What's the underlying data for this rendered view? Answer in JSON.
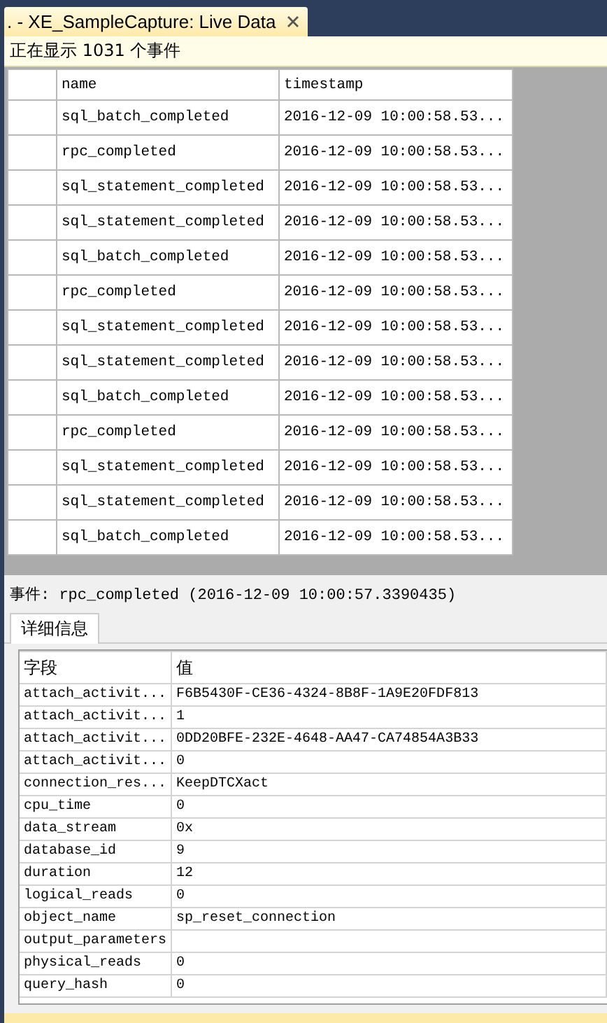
{
  "document_tab": {
    "title": ". - XE_SampleCapture: Live Data",
    "selected": true
  },
  "info_bar": {
    "text": "正在显示 1031 个事件"
  },
  "event_grid": {
    "columns": [
      "name",
      "timestamp"
    ],
    "rows": [
      {
        "name": "sql_batch_completed",
        "timestamp": "2016-12-09 10:00:58.53..."
      },
      {
        "name": "rpc_completed",
        "timestamp": "2016-12-09 10:00:58.53..."
      },
      {
        "name": "sql_statement_completed",
        "timestamp": "2016-12-09 10:00:58.53..."
      },
      {
        "name": "sql_statement_completed",
        "timestamp": "2016-12-09 10:00:58.53..."
      },
      {
        "name": "sql_batch_completed",
        "timestamp": "2016-12-09 10:00:58.53..."
      },
      {
        "name": "rpc_completed",
        "timestamp": "2016-12-09 10:00:58.53..."
      },
      {
        "name": "sql_statement_completed",
        "timestamp": "2016-12-09 10:00:58.53..."
      },
      {
        "name": "sql_statement_completed",
        "timestamp": "2016-12-09 10:00:58.53..."
      },
      {
        "name": "sql_batch_completed",
        "timestamp": "2016-12-09 10:00:58.53..."
      },
      {
        "name": "rpc_completed",
        "timestamp": "2016-12-09 10:00:58.53..."
      },
      {
        "name": "sql_statement_completed",
        "timestamp": "2016-12-09 10:00:58.53..."
      },
      {
        "name": "sql_statement_completed",
        "timestamp": "2016-12-09 10:00:58.53..."
      },
      {
        "name": "sql_batch_completed",
        "timestamp": "2016-12-09 10:00:58.53..."
      }
    ]
  },
  "event_label": "事件: rpc_completed (2016-12-09 10:00:57.3390435)",
  "detail_tabs": [
    {
      "label": "详细信息",
      "selected": true
    }
  ],
  "details": {
    "columns": [
      "字段",
      "值"
    ],
    "rows": [
      {
        "field": "attach_activit...",
        "value": "F6B5430F-CE36-4324-8B8F-1A9E20FDF813"
      },
      {
        "field": "attach_activit...",
        "value": "1"
      },
      {
        "field": "attach_activit...",
        "value": "0DD20BFE-232E-4648-AA47-CA74854A3B33"
      },
      {
        "field": "attach_activit...",
        "value": "0"
      },
      {
        "field": "connection_res...",
        "value": "KeepDTCXact"
      },
      {
        "field": "cpu_time",
        "value": "0"
      },
      {
        "field": "data_stream",
        "value": "0x"
      },
      {
        "field": "database_id",
        "value": "9"
      },
      {
        "field": "duration",
        "value": "12"
      },
      {
        "field": "logical_reads",
        "value": "0"
      },
      {
        "field": "object_name",
        "value": "sp_reset_connection"
      },
      {
        "field": "output_parameters"
      },
      {
        "field": "physical_reads",
        "value": "0"
      },
      {
        "field": "query_hash",
        "value": "0"
      }
    ]
  }
}
